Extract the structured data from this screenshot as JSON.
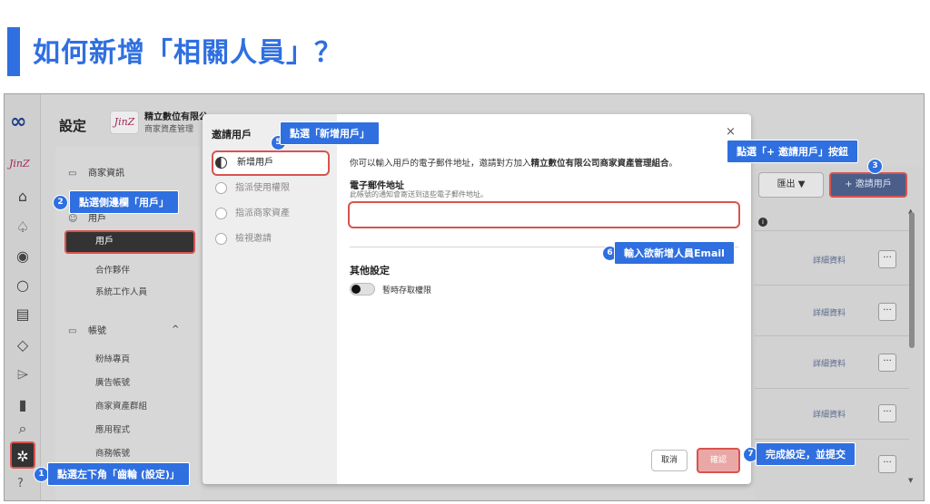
{
  "heading": "如何新增「相關人員」？",
  "rail": {
    "logo": "∞",
    "brand": "JinZ",
    "help": "?"
  },
  "settings": {
    "title": "設定",
    "business_logo_text": "JinZ",
    "business_name": "精立數位有限公",
    "business_sub": "商家資產管理"
  },
  "sidebar": {
    "business_info": "商家資訊",
    "users_group": "用戶",
    "users": "用戶",
    "partners": "合作夥伴",
    "system_users": "系統工作人員",
    "accounts": "帳號",
    "accounts_caret": "^",
    "pages": "粉絲專頁",
    "ad_accounts": "廣告帳號",
    "asset_groups": "商家資產群組",
    "apps": "應用程式",
    "business_accounts": "商務帳號"
  },
  "table": {
    "export_label": "匯出 ▼",
    "invite_label": "+ 邀請用戶",
    "detail_label": "詳細資料",
    "more_label": "···",
    "rows": 5
  },
  "modal": {
    "title": "邀請用戶",
    "close": "×",
    "steps": [
      "新增用戶",
      "指派使用權限",
      "指派商家資產",
      "檢視邀請"
    ],
    "description_prefix": "你可以輸入用戶的電子郵件地址，邀請對方加入",
    "description_bold": "精立數位有限公司商家資產管理組合",
    "description_suffix": "。",
    "email_label": "電子郵件地址",
    "email_help": "此帳號的通知會寄送到這些電子郵件地址。",
    "email_value": "",
    "other_settings": "其他設定",
    "toggle_label": "暫時存取權限",
    "toggle_on": false,
    "cancel": "取消",
    "confirm": "確認"
  },
  "callouts": {
    "c1": {
      "num": "1",
      "text": "點選左下角「齒輪 (設定)」"
    },
    "c2": {
      "num": "2",
      "text": "點選側邊欄「用戶」"
    },
    "c3": {
      "num": "3",
      "text": "點選「+ 邀請用戶」按鈕"
    },
    "c5": {
      "num": "5",
      "text": "點選「新增用戶」"
    },
    "c6": {
      "num": "6",
      "text": "輸入欲新增人員Email"
    },
    "c7": {
      "num": "7",
      "text": "完成設定，並提交"
    }
  },
  "colors": {
    "accent": "#2f6fe0",
    "highlight": "#d9534f",
    "invite_button": "#4a5e89"
  }
}
